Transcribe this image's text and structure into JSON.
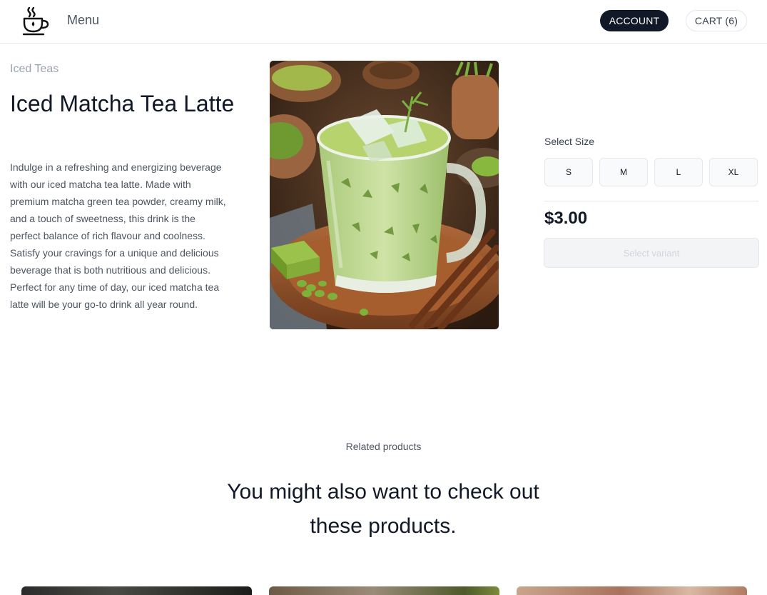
{
  "header": {
    "menu_label": "Menu",
    "account_label": "ACCOUNT",
    "cart_label": "CART (6)",
    "logo_icon": "coffee-cup-icon"
  },
  "product": {
    "category": "Iced Teas",
    "title": "Iced Matcha Tea Latte",
    "description": "Indulge in a refreshing and energizing beverage with our iced matcha tea latte. Made with premium matcha green tea powder, creamy milk, and a touch of sweetness, this drink is the perfect balance of rich flavour and coolness. Satisfy your cravings for a unique and delicious beverage that is both nutritious and delicious. Perfect for any time of day, our iced matcha tea latte will be your go-to drink all year round."
  },
  "purchase": {
    "size_label": "Select Size",
    "sizes": [
      "S",
      "M",
      "L",
      "XL"
    ],
    "price": "$3.00",
    "button_label": "Select variant"
  },
  "related": {
    "label": "Related products",
    "heading": "You might also want to check out these products."
  },
  "colors": {
    "accent_dark": "#111827",
    "matcha_green": "#b9d48a"
  }
}
